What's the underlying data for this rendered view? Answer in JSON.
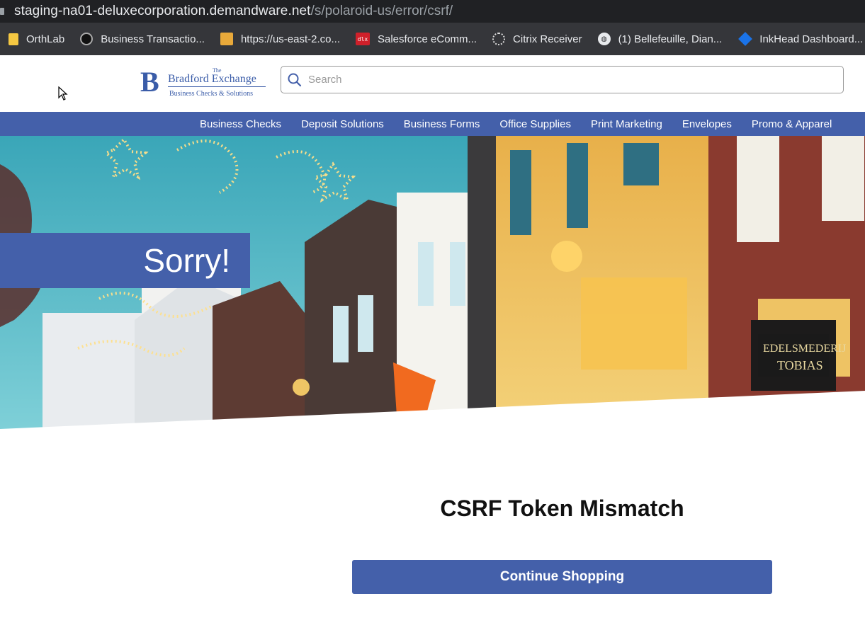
{
  "browser": {
    "url_host": "staging-na01-deluxecorporation.demandware.net",
    "url_path": "/s/polaroid-us/error/csrf/",
    "bookmarks": [
      {
        "label": "OrthLab",
        "icon": "folder-icon"
      },
      {
        "label": "Business Transactio...",
        "icon": "app-icon"
      },
      {
        "label": "https://us-east-2.co...",
        "icon": "aws-box-icon"
      },
      {
        "label": "Salesforce eComm...",
        "icon": "dlx-icon"
      },
      {
        "label": "Citrix Receiver",
        "icon": "citrix-icon"
      },
      {
        "label": "(1) Bellefeuille, Dian...",
        "icon": "globe-icon"
      },
      {
        "label": "InkHead Dashboard...",
        "icon": "diamond-icon"
      }
    ],
    "dlx_badge": "dlx"
  },
  "header": {
    "logo": {
      "the": "The",
      "name": "Bradford Exchange",
      "tagline": "Business Checks & Solutions"
    },
    "search_placeholder": "Search"
  },
  "nav": {
    "items": [
      "Business Checks",
      "Deposit Solutions",
      "Business Forms",
      "Office Supplies",
      "Print Marketing",
      "Envelopes",
      "Promo & Apparel"
    ]
  },
  "hero": {
    "heading": "Sorry!"
  },
  "main": {
    "message": "CSRF Token Mismatch",
    "cta_label": "Continue Shopping"
  },
  "colors": {
    "brand": "#4460aa",
    "browser_dark": "#202124",
    "bookmarks_bar": "#35363a"
  }
}
